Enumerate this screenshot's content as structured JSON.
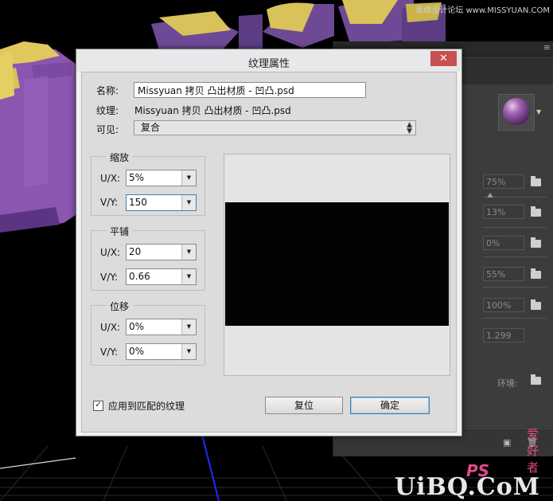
{
  "watermarks": {
    "top": "思缘设计论坛 www.MISSYUAN.COM",
    "ps": "PS",
    "cn": "爱好者",
    "uibq": "UiBQ.CoM"
  },
  "dialog": {
    "title": "纹理属性",
    "close_glyph": "✕",
    "name_label": "名称:",
    "name_value": "Missyuan 拷贝 凸出材质 - 凹凸.psd",
    "texture_label": "纹理:",
    "texture_value": "Missyuan 拷贝 凸出材质 - 凹凸.psd",
    "visible_label": "可见:",
    "visible_value": "复合",
    "scale": {
      "title": "缩放",
      "u_label": "U/X:",
      "u_value": "5%",
      "v_label": "V/Y:",
      "v_value": "150"
    },
    "tile": {
      "title": "平铺",
      "u_label": "U/X:",
      "u_value": "20",
      "v_label": "V/Y:",
      "v_value": "0.66"
    },
    "offset": {
      "title": "位移",
      "u_label": "U/X:",
      "u_value": "0%",
      "v_label": "V/Y:",
      "v_value": "0%"
    },
    "apply_checkbox_label": "应用到匹配的纹理",
    "apply_checked": true,
    "reset_button": "复位",
    "ok_button": "确定"
  },
  "panel": {
    "fields": [
      "75%",
      "13%",
      "0%",
      "55%",
      "100%",
      "1.299"
    ],
    "env_label": "环境:"
  }
}
